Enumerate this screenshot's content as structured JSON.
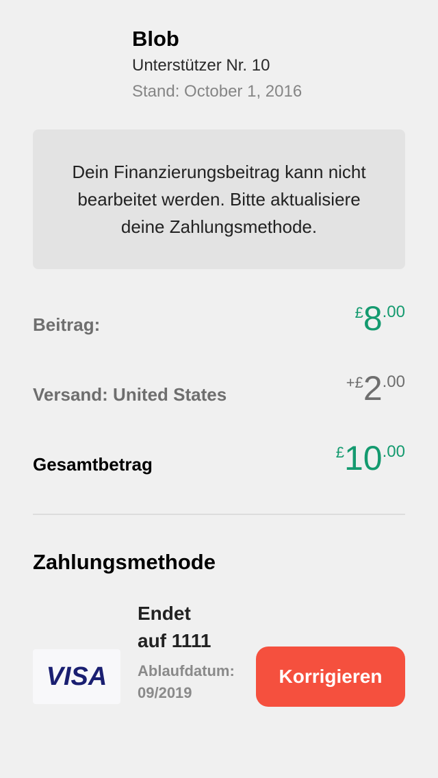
{
  "project": {
    "name": "Blob",
    "backer_number": "Unterstützer Nr. 10",
    "status_date": "Stand: October 1, 2016"
  },
  "notice": "Dein Finanzierungsbeitrag kann nicht bearbeitet werden. Bitte aktualisiere deine Zahlungsmethode.",
  "pledge": {
    "label": "Beitrag:",
    "sign": "£",
    "whole": "8",
    "cents": ".00"
  },
  "shipping": {
    "label": "Versand: United States",
    "sign": "+£",
    "whole": "2",
    "cents": ".00"
  },
  "total": {
    "label": "Gesamtbetrag",
    "sign": "£",
    "whole": "10",
    "cents": ".00"
  },
  "payment": {
    "title": "Zahlungsmethode",
    "card_brand": "VISA",
    "card_ends": "Endet auf 1111",
    "card_expiry": "Ablaufdatum: 09/2019",
    "fix_label": "Korrigieren"
  },
  "colors": {
    "accent_green": "#149a6f",
    "button_red": "#f5503e",
    "visa_blue": "#1a1f71"
  }
}
